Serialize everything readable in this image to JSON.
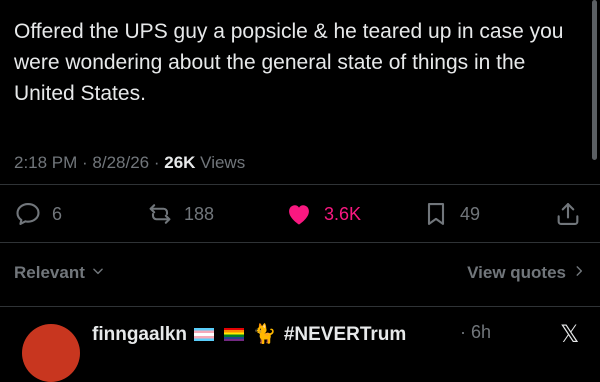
{
  "tweet": {
    "text": "Offered the UPS guy a popsicle & he teared up in case you were wondering about the general state of things in the United States.",
    "time": "2:18 PM · 8/28/26 · ",
    "views_count": "26K",
    "views_label": " Views"
  },
  "actions": {
    "replies": "6",
    "reposts": "188",
    "likes": "3.6K",
    "bookmarks": "49"
  },
  "colors": {
    "like": "#f91880",
    "muted": "#71767b",
    "text": "#e7e9ea"
  },
  "sort": {
    "label": "Relevant",
    "quotes_label": "View quotes"
  },
  "reply": {
    "name": "finngaalkn",
    "tag": "#NEVERTrum",
    "time": "· 6h",
    "logo": "𝕏"
  }
}
